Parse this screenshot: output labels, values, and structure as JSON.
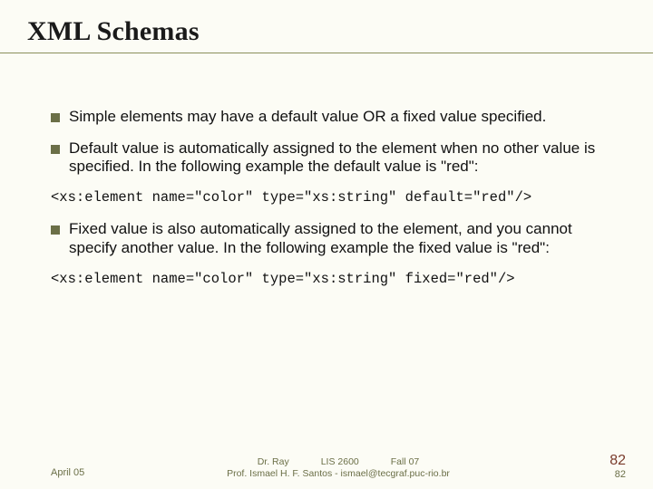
{
  "title": "XML Schemas",
  "bullets": [
    "Simple elements may have a default value OR a fixed value specified.",
    "Default value is automatically assigned to the element when no other value is specified. In the following example the default value is \"red\":",
    "Fixed value is also automatically assigned to the element, and you cannot specify another value.  In the following example the fixed value is \"red\":"
  ],
  "code": [
    "<xs:element name=\"color\" type=\"xs:string\" default=\"red\"/>",
    "<xs:element name=\"color\" type=\"xs:string\" fixed=\"red\"/>"
  ],
  "footer": {
    "left": "April 05",
    "center_top": "Dr. Ray            LIS 2600            Fall 07",
    "center_bottom": "Prof. Ismael H. F. Santos -  ismael@tecgraf.puc-rio.br",
    "page_big": "82",
    "page_small": "82"
  }
}
